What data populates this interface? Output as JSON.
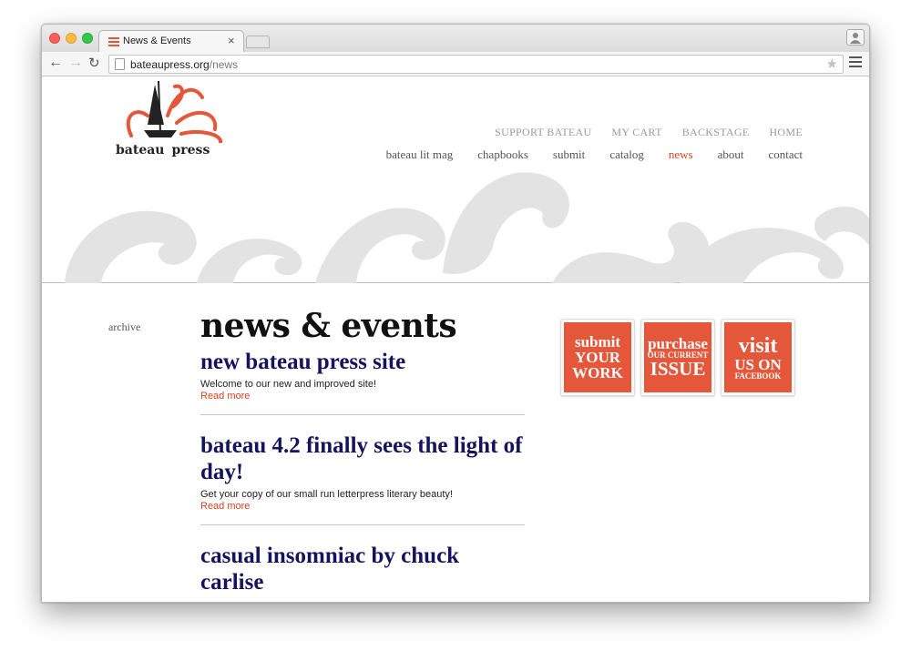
{
  "browser": {
    "tab_title": "News & Events",
    "tab_close": "×",
    "url_host": "bateaupress.org",
    "url_path": "/news",
    "back_icon": "←",
    "forward_icon": "→",
    "reload_icon": "↻",
    "star_icon": "★"
  },
  "site": {
    "logo_word_1": "bateau",
    "logo_word_2": "press",
    "accent_color": "#d8411f",
    "util_nav": [
      "SUPPORT BATEAU",
      "MY CART",
      "BACKSTAGE",
      "HOME"
    ],
    "main_nav": [
      "bateau lit mag",
      "chapbooks",
      "submit",
      "catalog",
      "news",
      "about",
      "contact"
    ],
    "active_nav": "news"
  },
  "sidebar": {
    "archive_label": "archive"
  },
  "main": {
    "title": "news & events",
    "posts": [
      {
        "title": "new bateau press site",
        "excerpt": "Welcome to our new and improved site!",
        "read_more": "Read more"
      },
      {
        "title": "bateau 4.2 finally sees the light of day!",
        "excerpt": "Get your copy of our small run letterpress literary beauty!",
        "read_more": "Read more"
      },
      {
        "title": "casual insomniac by chuck carlise"
      }
    ]
  },
  "promos": [
    {
      "line1": "submit",
      "line2": "YOUR",
      "line3": "WORK"
    },
    {
      "line1": "purchase",
      "line2": "OUR CURRENT",
      "line3": "ISSUE"
    },
    {
      "line1": "visit",
      "line2": "US ON",
      "line3": "FACEBOOK"
    }
  ],
  "colors": {
    "promo_bg": "#e4573a",
    "post_title": "#15125f"
  }
}
